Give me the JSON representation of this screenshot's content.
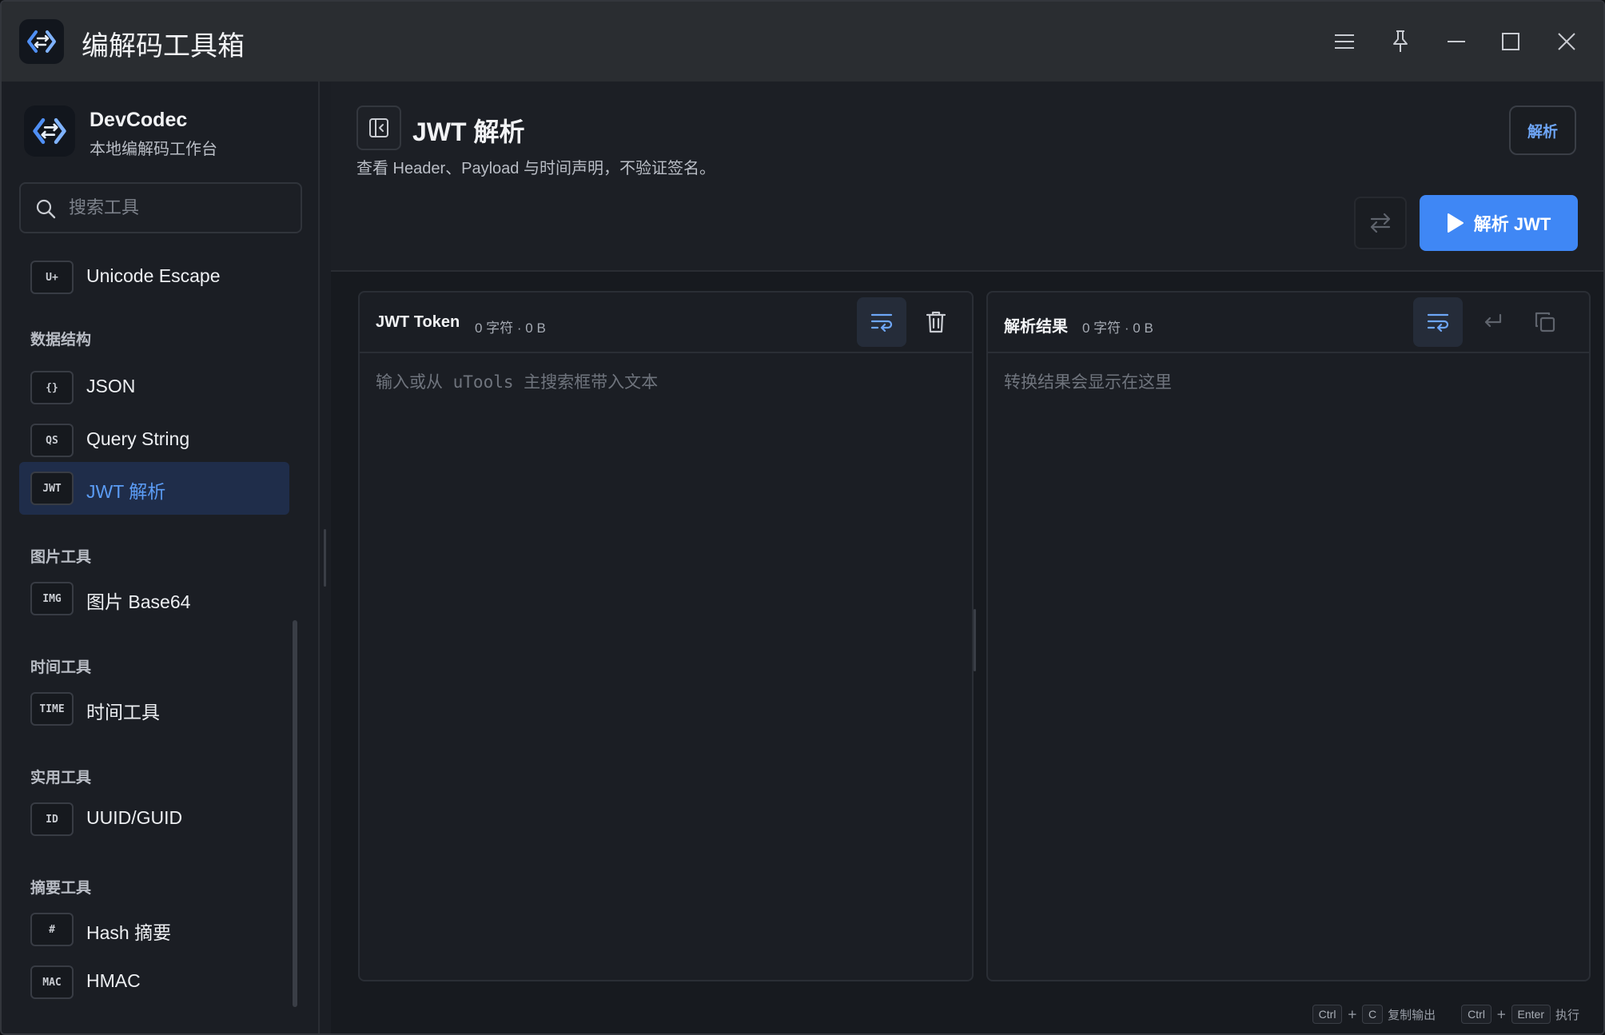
{
  "app": {
    "title": "编解码工具箱"
  },
  "window_controls": [
    "menu-icon",
    "pin-icon",
    "minimize-icon",
    "maximize-icon",
    "close-icon"
  ],
  "sidebar": {
    "brand_name": "DevCodec",
    "brand_subtitle": "本地编解码工作台",
    "search_placeholder": "搜索工具",
    "items": [
      {
        "badge": "U+",
        "label": "Unicode Escape"
      },
      {
        "section": "数据结构"
      },
      {
        "badge": "{}",
        "label": "JSON"
      },
      {
        "badge": "QS",
        "label": "Query String"
      },
      {
        "badge": "JWT",
        "label": "JWT 解析",
        "active": true
      },
      {
        "section": "图片工具"
      },
      {
        "badge": "IMG",
        "label": "图片 Base64"
      },
      {
        "section": "时间工具"
      },
      {
        "badge": "TIME",
        "label": "时间工具"
      },
      {
        "section": "实用工具"
      },
      {
        "badge": "ID",
        "label": "UUID/GUID"
      },
      {
        "section": "摘要工具"
      },
      {
        "badge": "#",
        "label": "Hash 摘要"
      },
      {
        "badge": "MAC",
        "label": "HMAC"
      }
    ]
  },
  "main": {
    "title": "JWT 解析",
    "description": "查看 Header、Payload 与时间声明，不验证签名。",
    "tag_button": "解析",
    "run_button": "解析 JWT",
    "input_panel": {
      "title": "JWT Token",
      "stats": "0 字符 · 0 B",
      "placeholder": "输入或从 uTools 主搜索框带入文本",
      "value": ""
    },
    "output_panel": {
      "title": "解析结果",
      "stats": "0 字符 · 0 B",
      "placeholder": "转换结果会显示在这里",
      "value": ""
    }
  },
  "shortcuts": [
    {
      "keys": [
        "Ctrl",
        "C"
      ],
      "action": "复制输出"
    },
    {
      "keys": [
        "Ctrl",
        "Enter"
      ],
      "action": "执行"
    }
  ],
  "colors": {
    "accent": "#3f87f5",
    "active_bg": "#1f2d4a",
    "active_text": "#5b9cf5",
    "titlebar": "#2a2d31"
  }
}
